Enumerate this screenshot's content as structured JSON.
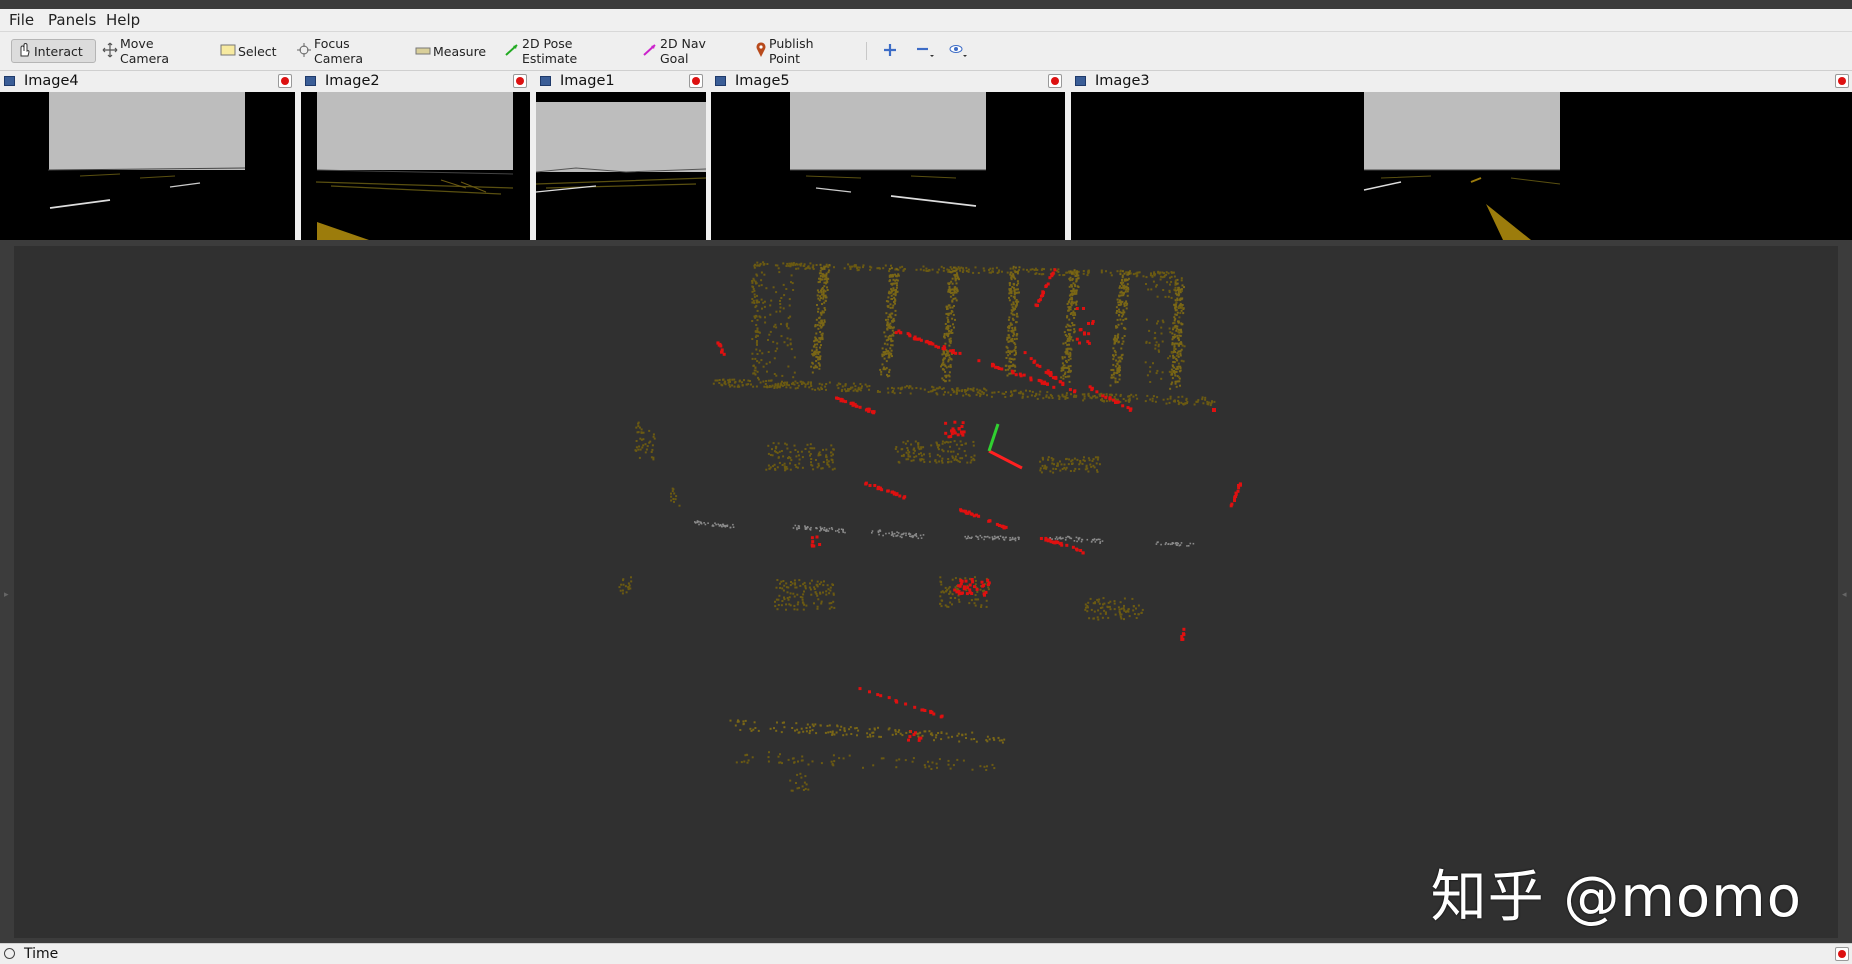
{
  "menu": [
    {
      "label": "File"
    },
    {
      "label": "Panels"
    },
    {
      "label": "Help"
    }
  ],
  "toolbar": {
    "tools": [
      {
        "label": "Interact",
        "icon": "hand-icon",
        "active": true
      },
      {
        "label": "Move Camera",
        "icon": "move-icon"
      },
      {
        "label": "Select",
        "icon": "select-icon"
      },
      {
        "label": "Focus Camera",
        "icon": "focus-icon"
      },
      {
        "label": "Measure",
        "icon": "ruler-icon"
      },
      {
        "label": "2D Pose Estimate",
        "icon": "green-arrow-icon"
      },
      {
        "label": "2D Nav Goal",
        "icon": "magenta-arrow-icon"
      },
      {
        "label": "Publish Point",
        "icon": "pin-icon"
      }
    ]
  },
  "panels": [
    {
      "title": "Image4"
    },
    {
      "title": "Image2"
    },
    {
      "title": "Image1"
    },
    {
      "title": "Image5"
    },
    {
      "title": "Image3"
    }
  ],
  "timepanel": {
    "title": "Time"
  },
  "watermark": "知乎 @momo",
  "colors": {
    "background3d": "#303030",
    "points": "#6b5a12",
    "highlight": "#e01010",
    "axis_x": "#ff2020",
    "axis_y": "#30d030"
  }
}
